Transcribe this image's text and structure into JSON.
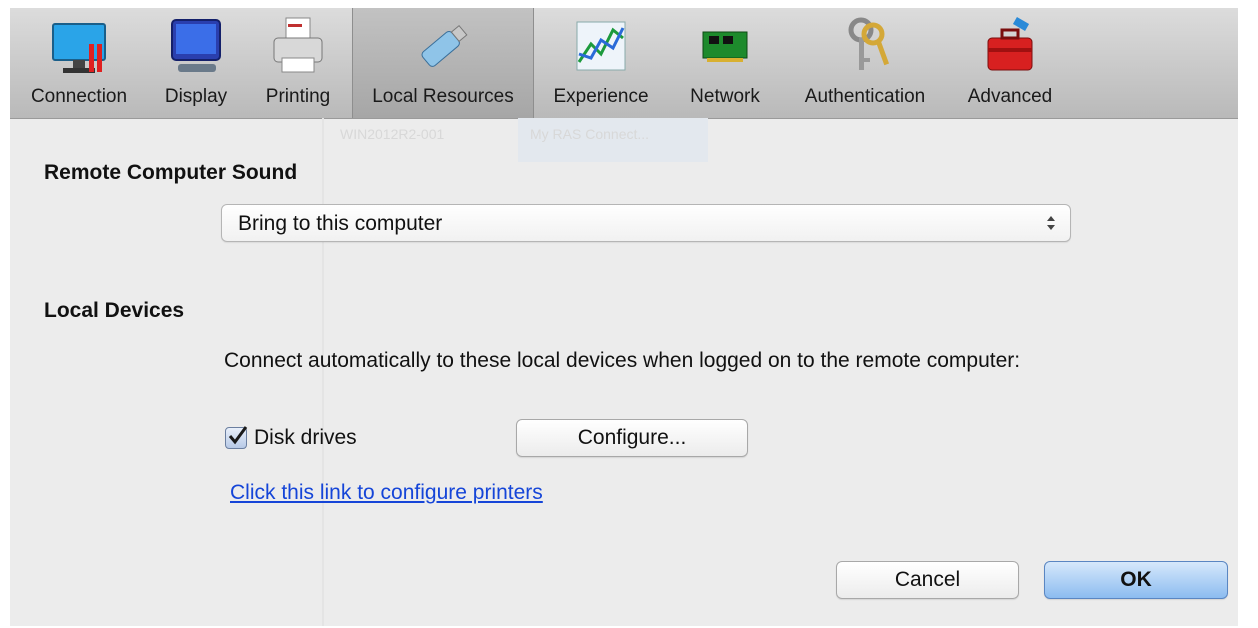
{
  "tabs": [
    {
      "label": "Connection",
      "icon": "monitor-connection-icon"
    },
    {
      "label": "Display",
      "icon": "display-monitor-icon"
    },
    {
      "label": "Printing",
      "icon": "printer-icon"
    },
    {
      "label": "Local Resources",
      "icon": "usb-drive-icon",
      "selected": true
    },
    {
      "label": "Experience",
      "icon": "chart-graph-icon"
    },
    {
      "label": "Network",
      "icon": "network-card-icon"
    },
    {
      "label": "Authentication",
      "icon": "keys-icon"
    },
    {
      "label": "Advanced",
      "icon": "toolbox-icon"
    }
  ],
  "background_ghost": {
    "left_text": "WIN2012R2-001",
    "right_text": "My RAS Connect..."
  },
  "sound": {
    "title": "Remote Computer Sound",
    "selected": "Bring to this computer"
  },
  "devices": {
    "title": "Local Devices",
    "description": "Connect automatically to these local devices when logged on to the remote computer:",
    "disk_drives_label": "Disk drives",
    "disk_drives_checked": true,
    "configure_label": "Configure...",
    "printers_link": "Click this link to configure printers"
  },
  "footer": {
    "cancel_label": "Cancel",
    "ok_label": "OK"
  },
  "colors": {
    "link": "#1545d8",
    "default_button": "#8cbcf0",
    "background": "#ececec"
  }
}
